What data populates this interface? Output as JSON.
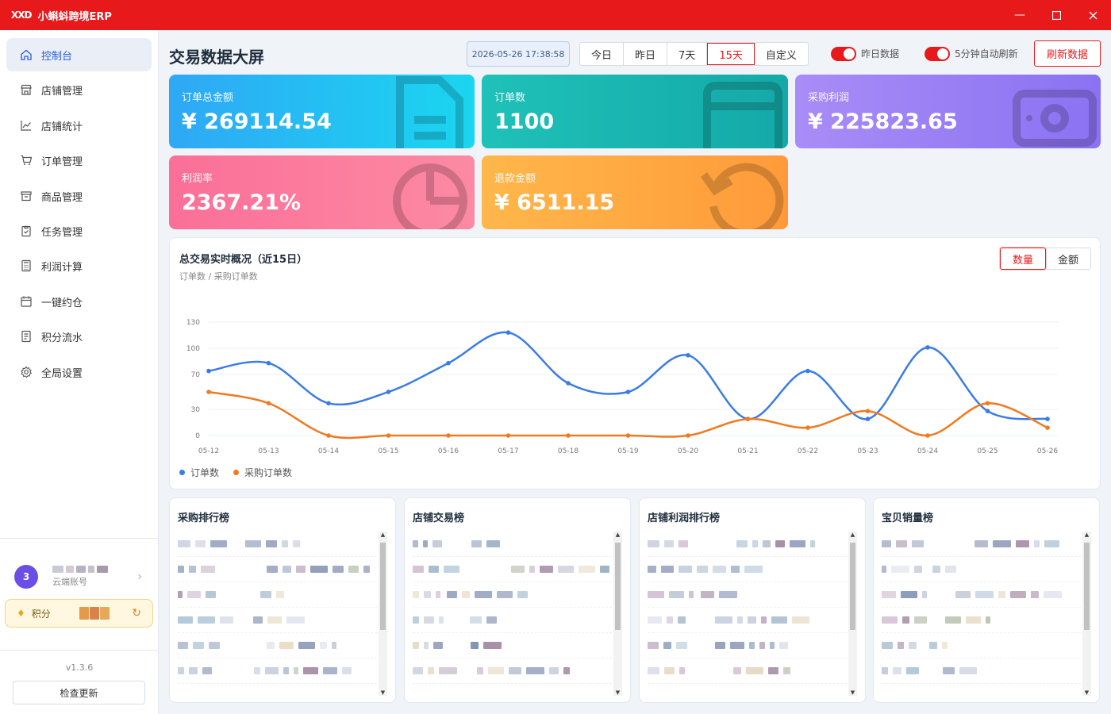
{
  "titlebar": {
    "logo": "XXD",
    "title": "小蝌蚪跨境ERP"
  },
  "colors": {
    "brand": "#e8191b",
    "accent": "#2b5cd6",
    "series1": "#3b7be8",
    "series2": "#f07a1f"
  },
  "sidebar": {
    "items": [
      {
        "label": "控制台",
        "icon": "home-icon",
        "active": true
      },
      {
        "label": "店铺管理",
        "icon": "store-icon"
      },
      {
        "label": "店铺统计",
        "icon": "line-chart-icon"
      },
      {
        "label": "订单管理",
        "icon": "cart-icon"
      },
      {
        "label": "商品管理",
        "icon": "box-icon"
      },
      {
        "label": "任务管理",
        "icon": "clipboard-icon"
      },
      {
        "label": "利润计算",
        "icon": "calculator-icon"
      },
      {
        "label": "一键约仓",
        "icon": "calendar-icon"
      },
      {
        "label": "积分流水",
        "icon": "document-icon"
      },
      {
        "label": "全局设置",
        "icon": "gear-icon"
      }
    ],
    "account": {
      "avatar": "3",
      "subtitle": "云端账号"
    },
    "points_label": "积分",
    "version": "v1.3.6",
    "check_update": "检查更新"
  },
  "header": {
    "title": "交易数据大屏",
    "datetime": "2026-05-26 17:38:58",
    "ranges": [
      "今日",
      "昨日",
      "7天",
      "15天",
      "自定义"
    ],
    "active_range": "15天",
    "toggle_yesterday": "昨日数据",
    "toggle_auto": "5分钟自动刷新",
    "refresh": "刷新数据"
  },
  "stats": [
    {
      "label": "订单总金额",
      "value": "¥ 269114.54"
    },
    {
      "label": "订单数",
      "value": "1100"
    },
    {
      "label": "采购利润",
      "value": "¥ 225823.65"
    },
    {
      "label": "利润率",
      "value": "2367.21%"
    },
    {
      "label": "退款金额",
      "value": "¥ 6511.15"
    }
  ],
  "chart_panel": {
    "title": "总交易实时概况（近15日）",
    "subtitle": "订单数 / 采购订单数",
    "metric_qty": "数量",
    "metric_amount": "金额"
  },
  "chart_data": {
    "type": "line",
    "x": [
      "05-12",
      "05-13",
      "05-14",
      "05-15",
      "05-16",
      "05-17",
      "05-18",
      "05-19",
      "05-20",
      "05-21",
      "05-22",
      "05-23",
      "05-24",
      "05-25",
      "05-26"
    ],
    "yticks": [
      0,
      30,
      70,
      100,
      130
    ],
    "ylim": [
      0,
      130
    ],
    "series": [
      {
        "name": "订单数",
        "values": [
          74,
          83,
          37,
          50,
          83,
          118,
          60,
          50,
          92,
          19,
          74,
          19,
          101,
          28,
          19
        ]
      },
      {
        "name": "采购订单数",
        "values": [
          50,
          37,
          0,
          0,
          0,
          0,
          0,
          0,
          0,
          19,
          9,
          28,
          0,
          37,
          9
        ]
      }
    ],
    "legend": "bottom-left",
    "grid": true
  },
  "rankings": [
    "采购排行榜",
    "店铺交易榜",
    "店铺利润排行榜",
    "宝贝销量榜"
  ]
}
